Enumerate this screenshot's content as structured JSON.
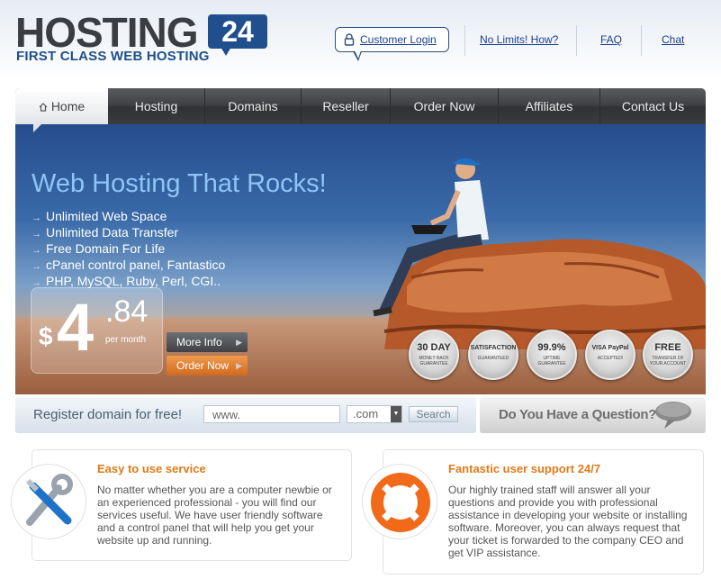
{
  "logo": {
    "word": "HOSTING",
    "badge": "24",
    "tagline": "FIRST CLASS WEB HOSTING"
  },
  "top_links": {
    "customer_login": "Customer Login",
    "no_limits": "No Limits! How?",
    "faq": "FAQ",
    "chat": "Chat"
  },
  "nav": {
    "items": [
      {
        "label": "Home"
      },
      {
        "label": "Hosting"
      },
      {
        "label": "Domains"
      },
      {
        "label": "Reseller"
      },
      {
        "label": "Order Now"
      },
      {
        "label": "Affiliates"
      },
      {
        "label": "Contact Us"
      }
    ]
  },
  "hero": {
    "title": "Web Hosting That Rocks!",
    "features": [
      "Unlimited Web Space",
      "Unlimited Data Transfer",
      "Free Domain For Life",
      "cPanel control panel, Fantastico",
      "PHP, MySQL, Ruby, Perl, CGI.."
    ],
    "price": {
      "currency": "$",
      "integer": "4",
      "cents": ".84",
      "period": "per month"
    },
    "more_info": "More Info",
    "order_now": "Order Now",
    "badges": [
      {
        "main": "30 DAY",
        "sub": "MONEY BACK GUARANTEE"
      },
      {
        "main": "SATISFACTION",
        "sub": "GUARANTEED"
      },
      {
        "main": "99.9%",
        "sub": "UPTIME GUARANTEE"
      },
      {
        "main": "VISA PayPal",
        "sub": "ACCEPTED!"
      },
      {
        "main": "FREE",
        "sub": "TRANSFER OF YOUR ACCOUNT"
      }
    ]
  },
  "domain": {
    "label": "Register domain for free!",
    "input_value": "www.",
    "tld": ".com",
    "search": "Search"
  },
  "question": {
    "label": "Do You Have a Question?"
  },
  "boxes": {
    "left": {
      "title": "Easy to use service",
      "text": "No matter whether you are a computer newbie or an experienced professional - you will find our services useful. We have user friendly software and a control panel that will help you get your website up and running."
    },
    "right": {
      "title": "Fantastic user support 24/7",
      "text": "Our highly trained staff will answer all your questions and provide you with professional assistance in developing your website or installing software. Moreover, you can always request that your ticket is forwarded to the company CEO and get VIP assistance."
    }
  },
  "colors": {
    "brand_blue": "#1f4f8c",
    "accent_orange": "#e07a17",
    "hero_title": "#8fc4f6"
  }
}
